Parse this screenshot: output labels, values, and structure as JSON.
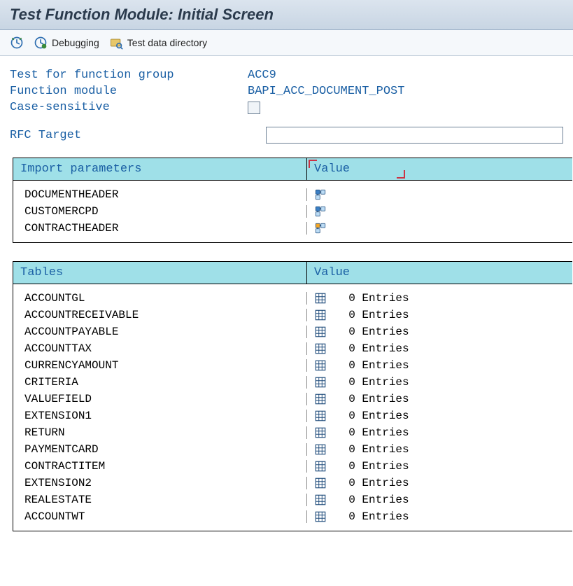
{
  "title": "Test Function Module: Initial Screen",
  "toolbar": {
    "debugging_label": "Debugging",
    "testdata_label": "Test data directory"
  },
  "info": {
    "fg_label": "Test for function group",
    "fg_value": "ACC9",
    "fm_label": "Function module",
    "fm_value": "BAPI_ACC_DOCUMENT_POST",
    "case_label": "Case-sensitive",
    "case_checked": false,
    "rfc_label": "RFC Target",
    "rfc_value": ""
  },
  "import_params": {
    "header_left": "Import parameters",
    "header_right": "Value",
    "rows": [
      {
        "name": "DOCUMENTHEADER",
        "highlight": false
      },
      {
        "name": "CUSTOMERCPD",
        "highlight": false
      },
      {
        "name": "CONTRACTHEADER",
        "highlight": true
      }
    ]
  },
  "tables": {
    "header_left": "Tables",
    "header_right": "Value",
    "entries_word": "Entries",
    "rows": [
      {
        "name": "ACCOUNTGL",
        "count": 0
      },
      {
        "name": "ACCOUNTRECEIVABLE",
        "count": 0
      },
      {
        "name": "ACCOUNTPAYABLE",
        "count": 0
      },
      {
        "name": "ACCOUNTTAX",
        "count": 0
      },
      {
        "name": "CURRENCYAMOUNT",
        "count": 0
      },
      {
        "name": "CRITERIA",
        "count": 0
      },
      {
        "name": "VALUEFIELD",
        "count": 0
      },
      {
        "name": "EXTENSION1",
        "count": 0
      },
      {
        "name": "RETURN",
        "count": 0
      },
      {
        "name": "PAYMENTCARD",
        "count": 0
      },
      {
        "name": "CONTRACTITEM",
        "count": 0
      },
      {
        "name": "EXTENSION2",
        "count": 0
      },
      {
        "name": "REALESTATE",
        "count": 0
      },
      {
        "name": "ACCOUNTWT",
        "count": 0
      }
    ]
  }
}
